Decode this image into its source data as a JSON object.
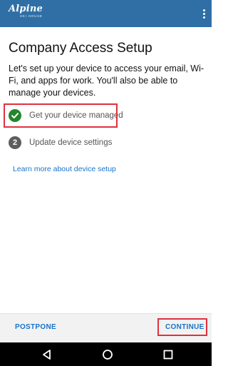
{
  "app_bar": {
    "logo_text": "Alpine",
    "logo_subtext": "SKI HOUSE",
    "overflow_icon": "more-vert-icon",
    "color": "#2f6fa6"
  },
  "page": {
    "title": "Company Access Setup",
    "intro": "Let's set up your device to access your email, Wi-Fi, and apps for work. You'll also be able to manage your devices."
  },
  "steps": [
    {
      "number": "1",
      "label": "Get your device managed",
      "status": "complete",
      "icon": "check-icon"
    },
    {
      "number": "2",
      "label": "Update device settings",
      "status": "pending"
    }
  ],
  "links": {
    "learn_more": "Learn more about device setup"
  },
  "bottom_bar": {
    "postpone_label": "POSTPONE",
    "continue_label": "CONTINUE"
  },
  "nav_bar": {
    "back_icon": "back-triangle-icon",
    "home_icon": "home-circle-icon",
    "recents_icon": "recents-square-icon"
  },
  "colors": {
    "accent": "#1a73c8",
    "success": "#23862e",
    "highlight": "#e0303e"
  }
}
